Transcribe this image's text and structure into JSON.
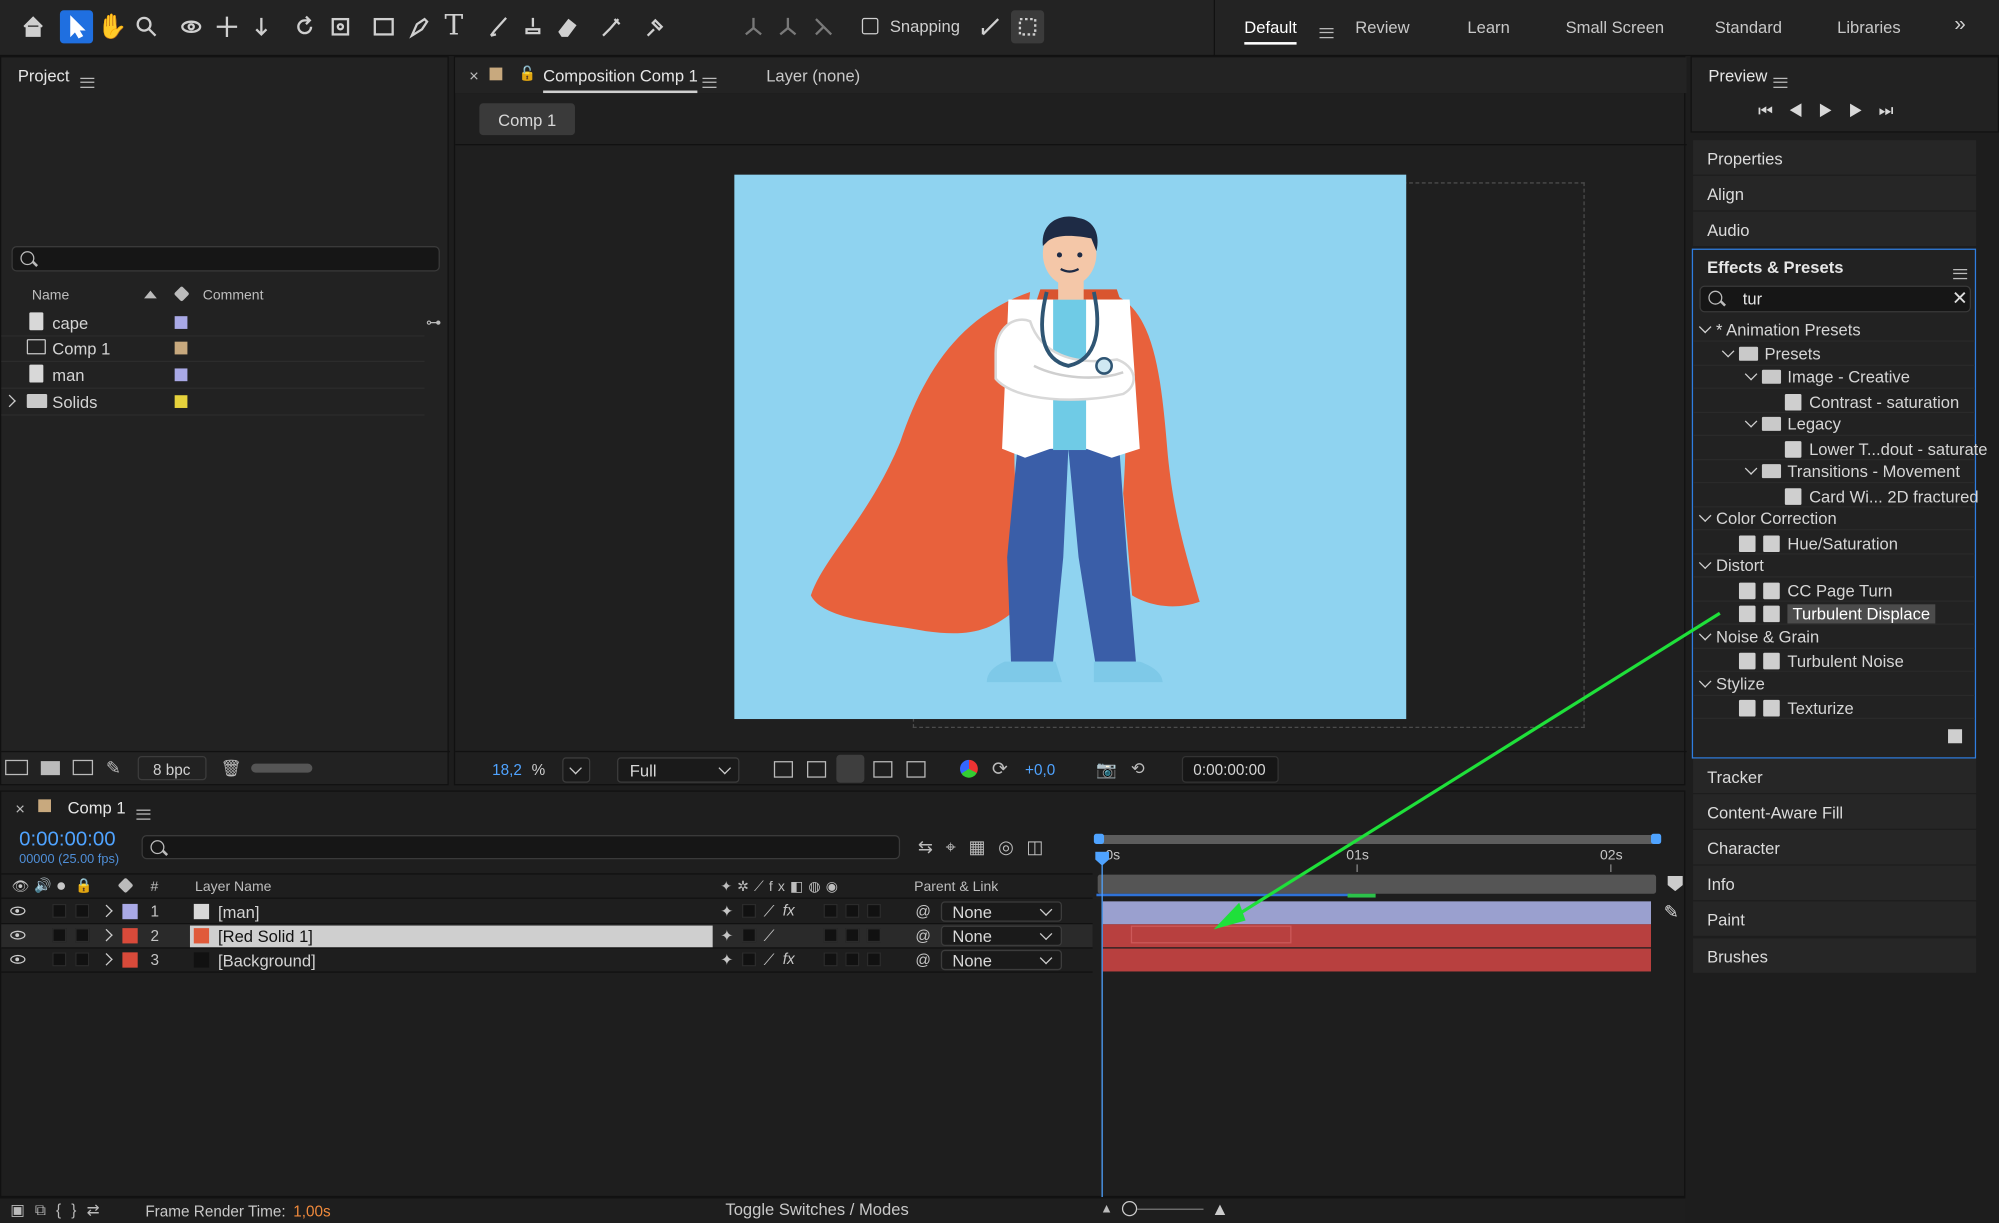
{
  "toolbar": {
    "snapping_label": "Snapping",
    "workspaces": [
      "Default",
      "Review",
      "Learn",
      "Small Screen",
      "Standard",
      "Libraries"
    ],
    "overflow_icon": "double-chevron-right-icon"
  },
  "project": {
    "title": "Project",
    "col_name": "Name",
    "col_comment": "Comment",
    "items": [
      {
        "name": "cape",
        "color": "#a9a9e6"
      },
      {
        "name": "Comp 1",
        "color": "#c8a97e"
      },
      {
        "name": "man",
        "color": "#a9a9e6"
      },
      {
        "name": "Solids",
        "color": "#e6d23c"
      }
    ],
    "bpc": "8 bpc"
  },
  "composition": {
    "tab_label": "Composition Comp 1",
    "layer_tab": "Layer (none)",
    "comp_button": "Comp 1",
    "zoom_value": "18,2",
    "zoom_unit": "%",
    "resolution": "Full",
    "exposure": "+0,0",
    "timecode": "0:00:00:00",
    "bg_color": "#8fd3f0"
  },
  "preview": {
    "title": "Preview"
  },
  "right_panels_top": [
    "Properties",
    "Align",
    "Audio"
  ],
  "effects": {
    "title": "Effects & Presets",
    "search_value": "tur",
    "tree": [
      {
        "label": "* Animation Presets",
        "level": 0,
        "type": "group"
      },
      {
        "label": "Presets",
        "level": 1,
        "type": "folder"
      },
      {
        "label": "Image - Creative",
        "level": 2,
        "type": "folder"
      },
      {
        "label": "Contrast - saturation",
        "level": 3,
        "type": "preset"
      },
      {
        "label": "Legacy",
        "level": 2,
        "type": "folder"
      },
      {
        "label": "Lower T...dout - saturate",
        "level": 3,
        "type": "preset"
      },
      {
        "label": "Transitions - Movement",
        "level": 2,
        "type": "folder"
      },
      {
        "label": "Card Wi... 2D fractured",
        "level": 3,
        "type": "preset"
      },
      {
        "label": "Color Correction",
        "level": 0,
        "type": "group"
      },
      {
        "label": "Hue/Saturation",
        "level": 1,
        "type": "effect"
      },
      {
        "label": "Distort",
        "level": 0,
        "type": "group"
      },
      {
        "label": "CC Page Turn",
        "level": 1,
        "type": "effect"
      },
      {
        "label": "Turbulent Displace",
        "level": 1,
        "type": "effect",
        "selected": true
      },
      {
        "label": "Noise & Grain",
        "level": 0,
        "type": "group"
      },
      {
        "label": "Turbulent Noise",
        "level": 1,
        "type": "effect"
      },
      {
        "label": "Stylize",
        "level": 0,
        "type": "group"
      },
      {
        "label": "Texturize",
        "level": 1,
        "type": "effect"
      }
    ]
  },
  "right_panels_bottom": [
    "Tracker",
    "Content-Aware Fill",
    "Character",
    "Info",
    "Paint",
    "Brushes"
  ],
  "timeline": {
    "tab": "Comp 1",
    "timecode": "0:00:00:00",
    "frame_info": "00000 (25.00 fps)",
    "col_num": "#",
    "col_layer": "Layer Name",
    "col_parent": "Parent & Link",
    "ruler": [
      "0s",
      "01s",
      "02s"
    ],
    "layers": [
      {
        "num": "1",
        "name": "[man]",
        "label_color": "#a9a9e6",
        "parent": "None",
        "selected": false
      },
      {
        "num": "2",
        "name": "[Red Solid 1]",
        "label_color": "#d94a3a",
        "parent": "None",
        "selected": true
      },
      {
        "num": "3",
        "name": "[Background]",
        "label_color": "#d94a3a",
        "parent": "None",
        "selected": false
      }
    ]
  },
  "status": {
    "render_label": "Frame Render Time:",
    "render_value": "1,00s",
    "toggle": "Toggle Switches / Modes"
  }
}
